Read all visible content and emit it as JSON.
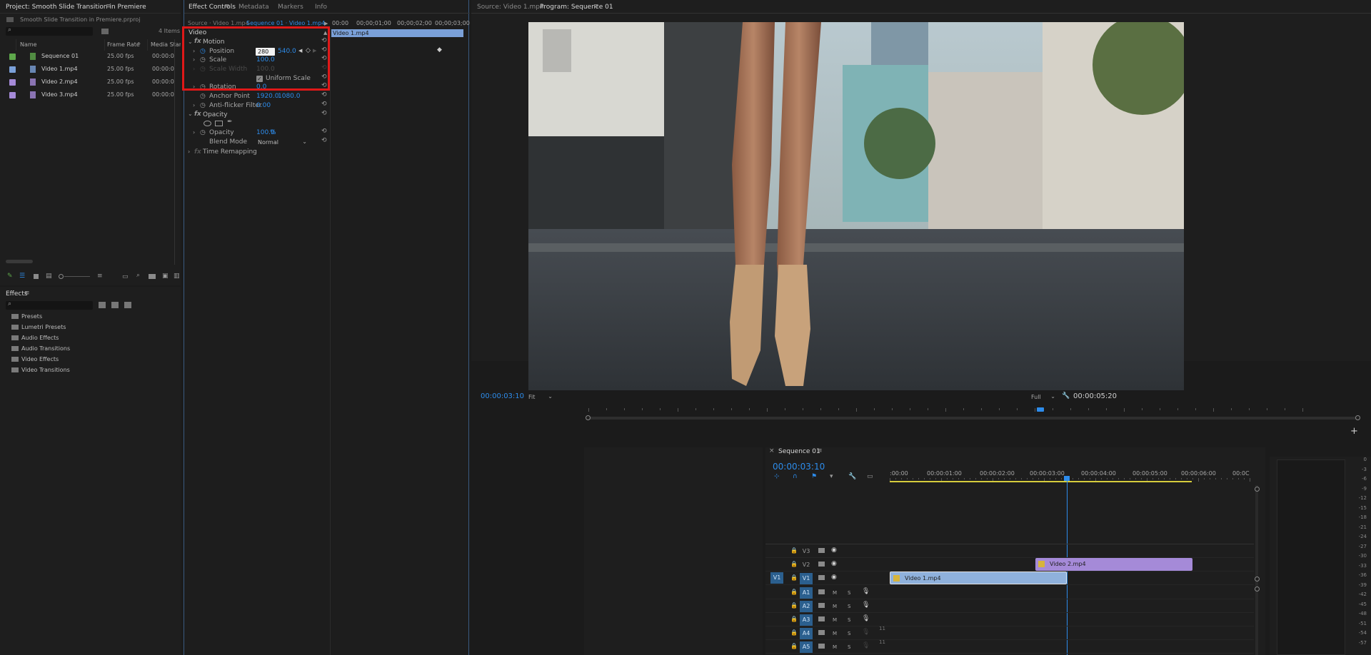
{
  "project": {
    "title": "Project: Smooth Slide Transition in Premiere",
    "file_name": "Smooth Slide Transition in Premiere.prproj",
    "items_count": "4 Items",
    "columns": {
      "name": "Name",
      "frame_rate": "Frame Rate",
      "media_start": "Media Star"
    },
    "items": [
      {
        "name": "Sequence 01",
        "fps": "25.00 fps",
        "start": "00:00:0",
        "color": "#5ea84b",
        "icon": "sequence-icon"
      },
      {
        "name": "Video 1.mp4",
        "fps": "25.00 fps",
        "start": "00:00:0",
        "color": "#7aa0d8",
        "icon": "video-file-icon"
      },
      {
        "name": "Video 2.mp4",
        "fps": "25.00 fps",
        "start": "00:00:0",
        "color": "#a58ad8",
        "icon": "video-file-icon"
      },
      {
        "name": "Video 3.mp4",
        "fps": "25.00 fps",
        "start": "00:00:0",
        "color": "#a58ad8",
        "icon": "video-file-icon"
      }
    ]
  },
  "effects_panel": {
    "title": "Effects",
    "items": [
      "Presets",
      "Lumetri Presets",
      "Audio Effects",
      "Audio Transitions",
      "Video Effects",
      "Video Transitions"
    ]
  },
  "effect_controls": {
    "tabs": [
      "Effect Controls",
      "Metadata",
      "Markers",
      "Info"
    ],
    "source_label": "Source · Video 1.mp4",
    "sequence_label": "Sequence 01 · Video 1.mp4",
    "clip_bar": "Video 1.mp4",
    "ruler": [
      "00:00",
      "00;00;01;00",
      "00;00;02;00",
      "00;00;03;00"
    ],
    "section_video": "Video",
    "motion": "Motion",
    "position_label": "Position",
    "position_x": "280",
    "position_y": "540.0",
    "scale_label": "Scale",
    "scale_value": "100.0",
    "scale_width_label": "Scale Width",
    "scale_width_value": "100.0",
    "uniform_scale": "Uniform Scale",
    "rotation_label": "Rotation",
    "rotation_value": "0.0",
    "anchor_label": "Anchor Point",
    "anchor_x": "1920.0",
    "anchor_y": "1080.0",
    "antiflicker_label": "Anti-flicker Filter",
    "antiflicker_value": "0.00",
    "opacity_section": "Opacity",
    "opacity_label": "Opacity",
    "opacity_value": "100.0",
    "opacity_unit": "%",
    "blend_label": "Blend Mode",
    "blend_value": "Normal",
    "time_remap": "Time Remapping",
    "highlight_color": "#e01818"
  },
  "source_monitor": {
    "tab": "Source: Video 1.mp4"
  },
  "program_monitor": {
    "tab": "Program: Sequence 01",
    "timecode": "00:00:03:10",
    "fit": "Fit",
    "quality": "Full",
    "duration": "00:00:05:20"
  },
  "timeline": {
    "title": "Sequence 01",
    "timecode": "00:00:03:10",
    "ruler": [
      ":00:00",
      "00:00:01:00",
      "00:00:02:00",
      "00:00:03:00",
      "00:00:04:00",
      "00:00:05:00",
      "00:00:06:00",
      "00:0C"
    ],
    "video_tracks": [
      "V3",
      "V2",
      "V1"
    ],
    "audio_tracks": [
      "A1",
      "A2",
      "A3",
      "A4",
      "A5"
    ],
    "source_patch_video": "V1",
    "track_m": "M",
    "track_s": "S",
    "clip_v1": "Video 1.mp4",
    "clip_v2": "Video 2.mp4",
    "clip_v1_color": "#8fb1dc",
    "clip_v2_color": "#a58ad8",
    "accent": "#2d8ceb"
  },
  "audio_meter": {
    "labels": [
      "0",
      "-3",
      "-6",
      "-9",
      "-12",
      "-15",
      "-18",
      "-21",
      "-24",
      "-27",
      "-30",
      "-33",
      "-36",
      "-39",
      "-42",
      "-45",
      "-48",
      "-51",
      "-54",
      "-57"
    ]
  }
}
